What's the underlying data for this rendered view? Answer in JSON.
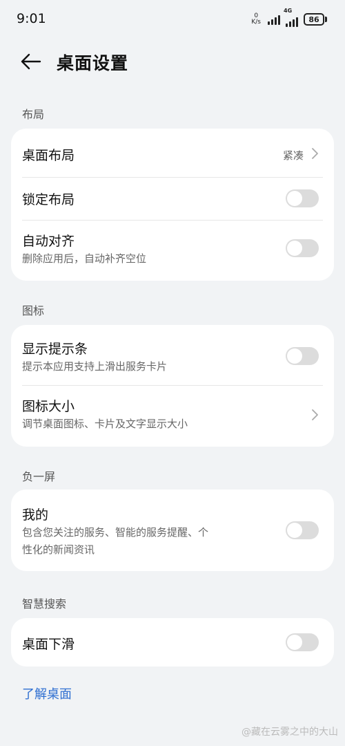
{
  "status_bar": {
    "time": "9:01",
    "net_speed_value": "0",
    "net_speed_unit": "K/s",
    "network_type": "4G",
    "battery": "86",
    "icons": [
      "signal-icon",
      "signal-4g-icon",
      "battery-icon"
    ]
  },
  "header": {
    "back_icon": "back-arrow-icon",
    "title": "桌面设置"
  },
  "sections": {
    "layout": {
      "label": "布局",
      "desktop_layout": {
        "title": "桌面布局",
        "value": "紧凑"
      },
      "lock_layout": {
        "title": "锁定布局",
        "enabled": false
      },
      "auto_align": {
        "title": "自动对齐",
        "subtitle": "删除应用后，自动补齐空位",
        "enabled": false
      }
    },
    "icons": {
      "label": "图标",
      "show_hint_bar": {
        "title": "显示提示条",
        "subtitle": "提示本应用支持上滑出服务卡片",
        "enabled": false
      },
      "icon_size": {
        "title": "图标大小",
        "subtitle": "调节桌面图标、卡片及文字显示大小"
      }
    },
    "minus_one_screen": {
      "label": "负一屏",
      "mine": {
        "title": "我的",
        "subtitle_line1": "包含您关注的服务、智能的服务提醒、个",
        "subtitle_line2": "性化的新闻资讯",
        "enabled": false
      }
    },
    "smart_search": {
      "label": "智慧搜索",
      "desktop_swipe_down": {
        "title": "桌面下滑",
        "enabled": false
      }
    }
  },
  "footer": {
    "learn_link": "了解桌面"
  },
  "watermark": "@藏在云雾之中的大山",
  "colors": {
    "background": "#f1f3f5",
    "card": "#ffffff",
    "link": "#2f6fd1",
    "toggle_off": "#dcdcdc"
  }
}
